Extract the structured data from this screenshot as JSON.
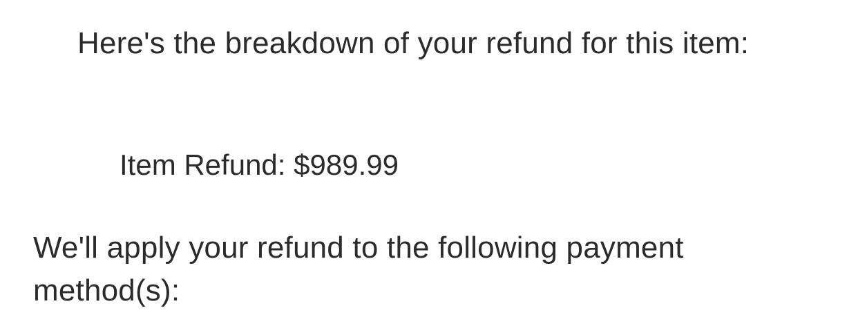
{
  "message": {
    "intro": "Here's the breakdown of your refund for this item:",
    "refund_label": "Item Refund:",
    "refund_amount": "$989.99",
    "payment_note": "We'll apply your refund to the following payment method(s):"
  }
}
